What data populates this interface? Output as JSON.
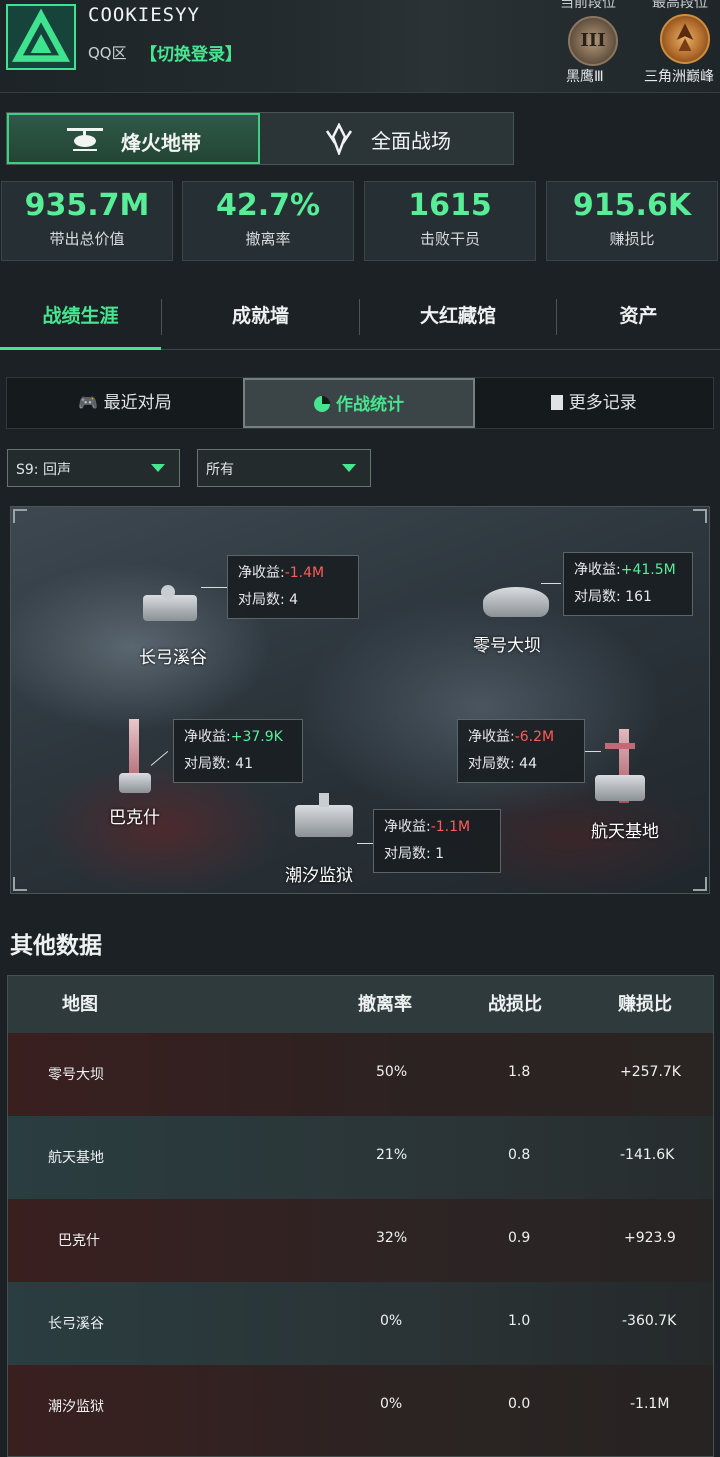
{
  "header": {
    "username": "COOKIESYY",
    "region": "QQ区",
    "switch_login": "【切换登录】",
    "rank_current_caption": "当前段位",
    "rank_highest_caption": "最高段位",
    "rank_current_name": "黑鹰Ⅲ",
    "rank_current_badge": "III",
    "rank_highest_name": "三角洲巅峰"
  },
  "mode_tabs": [
    {
      "label": "烽火地带",
      "icon": "helicopter-icon",
      "active": true
    },
    {
      "label": "全面战场",
      "icon": "crossed-arrows-icon",
      "active": false
    }
  ],
  "stats": [
    {
      "value": "935.7M",
      "label": "带出总价值"
    },
    {
      "value": "42.7%",
      "label": "撤离率"
    },
    {
      "value": "1615",
      "label": "击败干员"
    },
    {
      "value": "915.6K",
      "label": "赚损比"
    }
  ],
  "main_tabs": [
    "战绩生涯",
    "成就墙",
    "大红藏馆",
    "资产"
  ],
  "sub_tabs": [
    {
      "label": "最近对局",
      "icon": "gamepad-icon"
    },
    {
      "label": "作战统计",
      "icon": "pie-chart-icon"
    },
    {
      "label": "更多记录",
      "icon": "document-icon"
    }
  ],
  "filters": {
    "season": "S9: 回声",
    "scope": "所有"
  },
  "map": {
    "net_label": "净收益:",
    "matches_label": "对局数:",
    "maps": [
      {
        "name": "长弓溪谷",
        "net": "-1.4M",
        "matches": "4",
        "sign": "neg"
      },
      {
        "name": "零号大坝",
        "net": "+41.5M",
        "matches": "161",
        "sign": "pos"
      },
      {
        "name": "巴克什",
        "net": "+37.9K",
        "matches": "41",
        "sign": "pos"
      },
      {
        "name": "航天基地",
        "net": "-6.2M",
        "matches": "44",
        "sign": "neg"
      },
      {
        "name": "潮汐监狱",
        "net": "-1.1M",
        "matches": "1",
        "sign": "neg"
      }
    ]
  },
  "other": {
    "title": "其他数据",
    "headers": [
      "地图",
      "撤离率",
      "战损比",
      "赚损比"
    ],
    "rows": [
      [
        "零号大坝",
        "50%",
        "1.8",
        "+257.7K"
      ],
      [
        "航天基地",
        "21%",
        "0.8",
        "-141.6K"
      ],
      [
        "巴克什",
        "32%",
        "0.9",
        "+923.9"
      ],
      [
        "长弓溪谷",
        "0%",
        "1.0",
        "-360.7K"
      ],
      [
        "潮汐监狱",
        "0%",
        "0.0",
        "-1.1M"
      ]
    ]
  },
  "colors": {
    "accent": "#46e690",
    "negative": "#ff5a5a"
  }
}
